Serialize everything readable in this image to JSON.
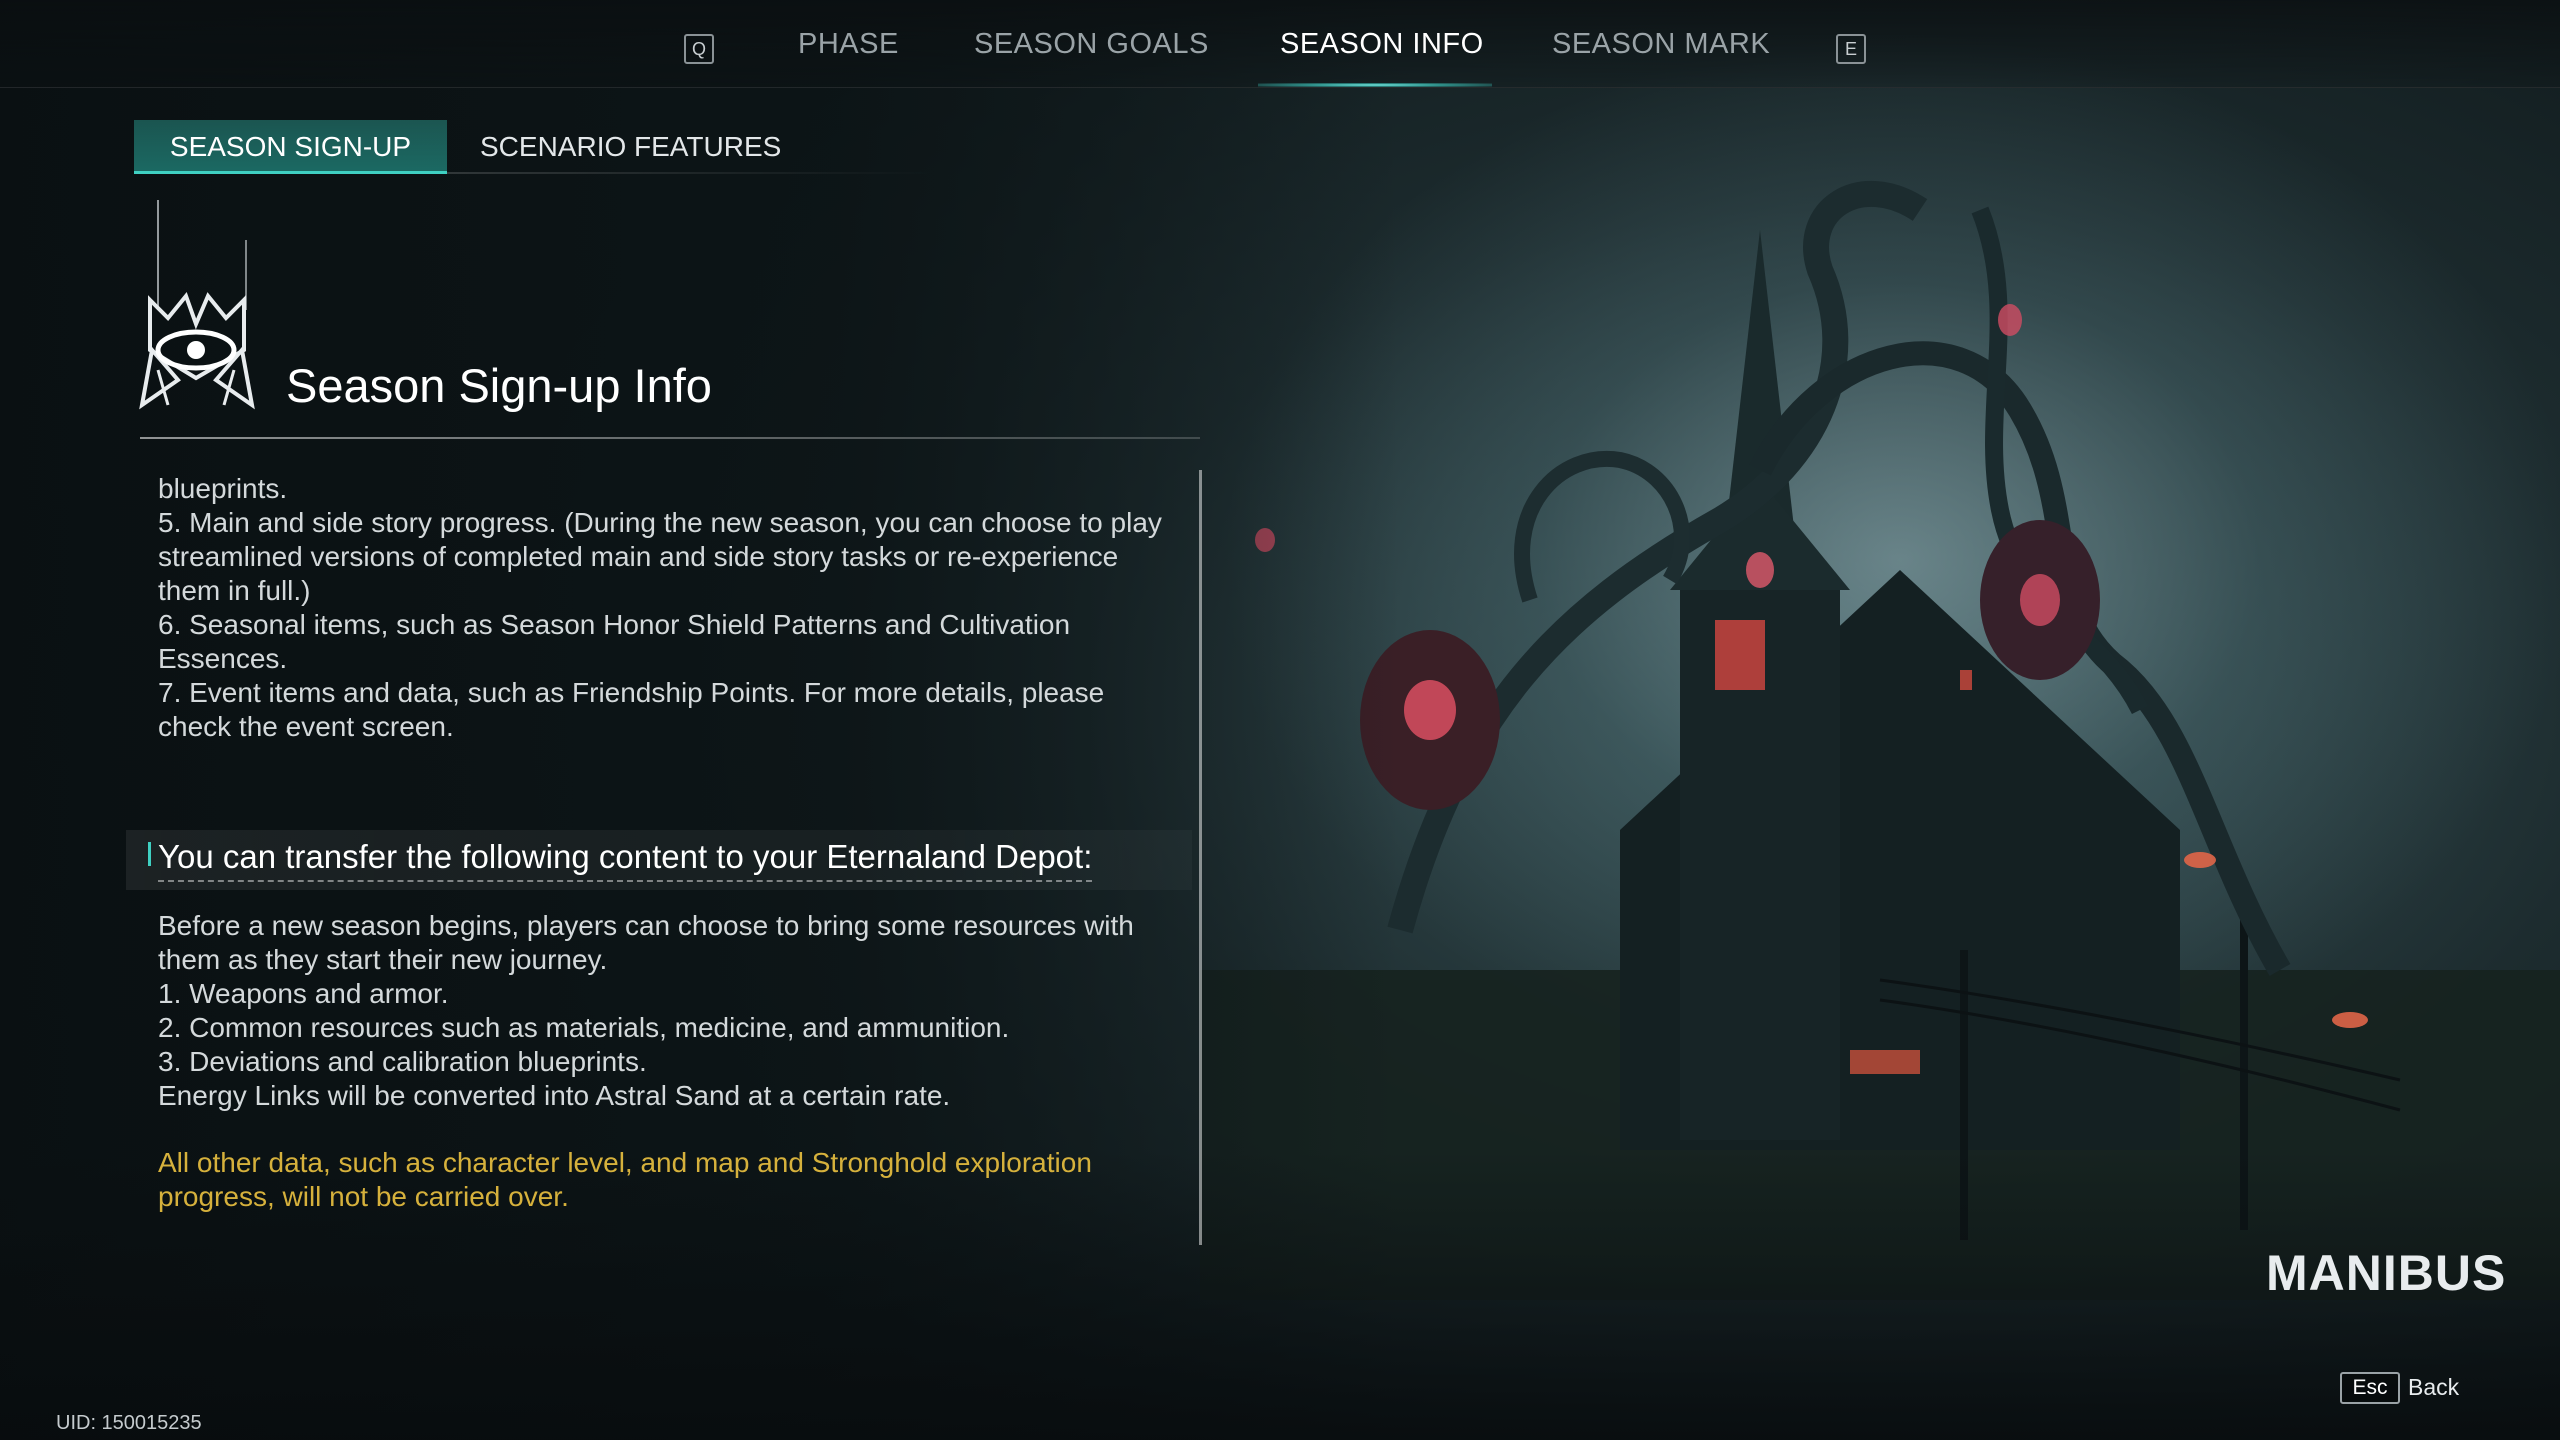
{
  "nav": {
    "prev_key": "Q",
    "next_key": "E",
    "tabs": [
      {
        "label": "PHASE",
        "active": false
      },
      {
        "label": "SEASON GOALS",
        "active": false
      },
      {
        "label": "SEASON INFO",
        "active": true
      },
      {
        "label": "SEASON MARK",
        "active": false
      }
    ]
  },
  "sub_tabs": [
    {
      "label": "SEASON SIGN-UP",
      "active": true
    },
    {
      "label": "SCENARIO FEATURES",
      "active": false
    }
  ],
  "section": {
    "title": "Season Sign-up Info"
  },
  "content": {
    "lines_top": [
      "blueprints.",
      "5. Main and side story progress. (During the new season, you can choose to play streamlined versions of completed main and side story tasks or re-experience them in full.)",
      "6. Seasonal items, such as Season Honor Shield Patterns and Cultivation Essences.",
      "7. Event items and data, such as Friendship Points. For more details, please check the event screen."
    ],
    "subheading": "You can transfer the following content to your Eternaland Depot:",
    "lines_bottom": [
      "Before a new season begins, players can choose to bring some resources with them as they start their new journey.",
      "1. Weapons and armor.",
      "2. Common resources such as materials, medicine, and ammunition.",
      "3. Deviations and calibration blueprints.",
      "Energy Links will be converted into Astral Sand at a certain rate."
    ],
    "warning": "All other data, such as character level, and map and Stronghold exploration progress, will not be carried over."
  },
  "footer": {
    "logo": "MANIBUS",
    "esc_key": "Esc",
    "back_label": "Back",
    "uid": "UID: 150015235"
  },
  "colors": {
    "accent": "#3fd0c2",
    "warning": "#d6b13c",
    "active_tab_bg": "#1e786f"
  },
  "icons": {
    "emblem": "eye-crest-icon"
  }
}
